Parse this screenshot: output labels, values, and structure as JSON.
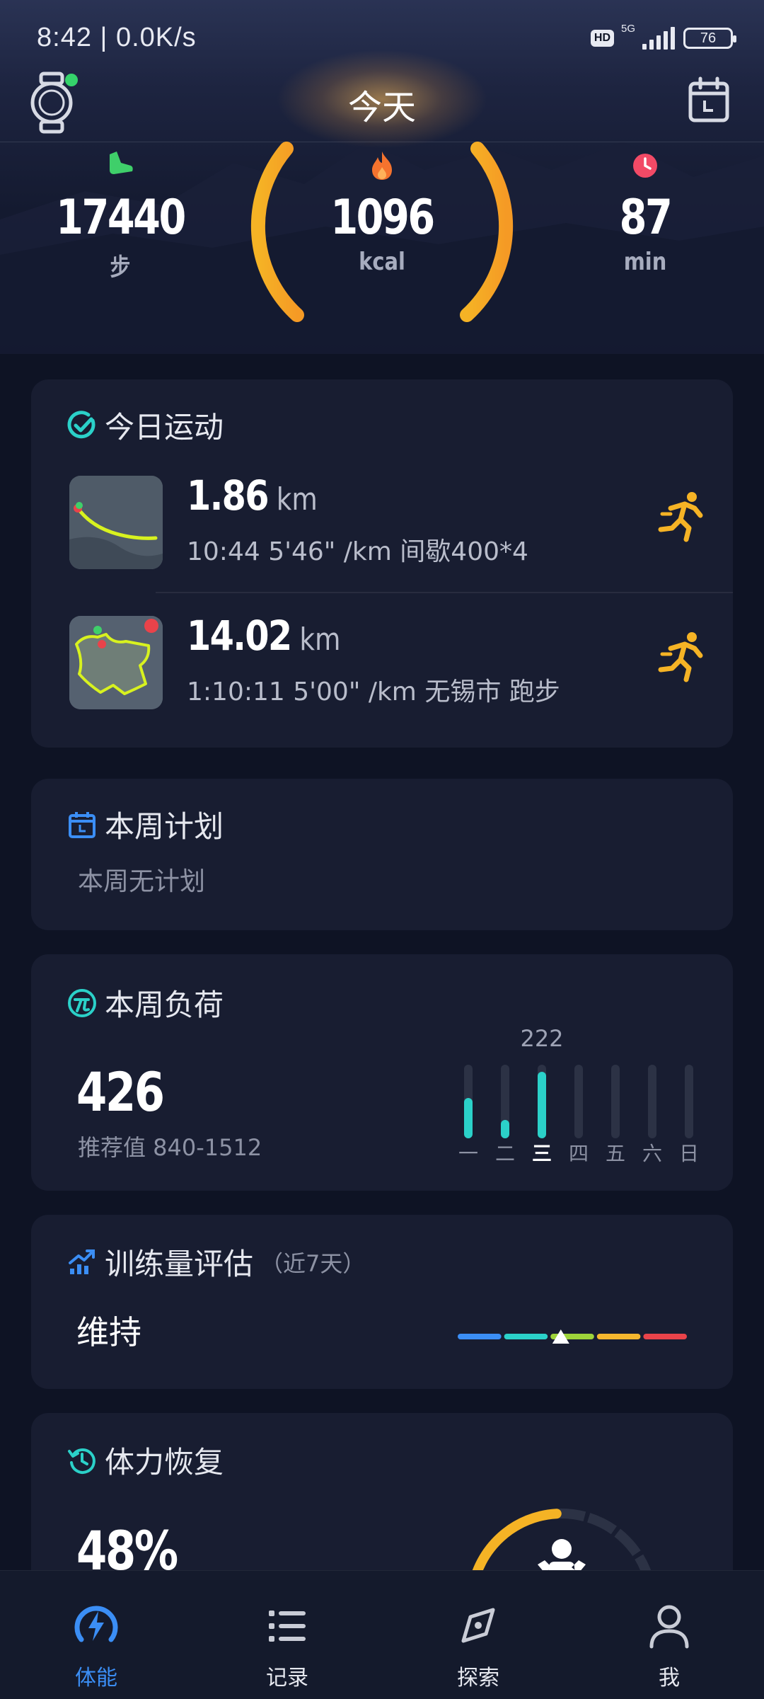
{
  "status_bar": {
    "time": "8:42 | 0.0K/s",
    "hd": "HD",
    "network": "5G",
    "battery": "76"
  },
  "header": {
    "title": "今天"
  },
  "stats": {
    "steps": {
      "value": "17440",
      "unit": "步"
    },
    "calories": {
      "value": "1096",
      "unit": "kcal"
    },
    "minutes": {
      "value": "87",
      "unit": "min"
    }
  },
  "today_exercise": {
    "title": "今日运动",
    "activities": [
      {
        "distance": "1.86",
        "unit": "km",
        "detail": "10:44 5'46\" /km  间歇400*4"
      },
      {
        "distance": "14.02",
        "unit": "km",
        "detail": "1:10:11 5'00\" /km  无锡市 跑步"
      }
    ]
  },
  "weekly_plan": {
    "title": "本周计划",
    "empty_text": "本周无计划"
  },
  "weekly_load": {
    "title": "本周负荷",
    "value": "426",
    "recommended": "推荐值 840-1512",
    "peak_label": "222",
    "days": [
      "一",
      "二",
      "三",
      "四",
      "五",
      "六",
      "日"
    ],
    "day_values": [
      0.55,
      0.25,
      0.9,
      0,
      0,
      0,
      0
    ],
    "today_index": 2
  },
  "training_assessment": {
    "title": "训练量评估",
    "subtitle": "（近7天）",
    "status": "维持",
    "indicator_position": 0.45,
    "segment_colors": [
      "#3b8ef5",
      "#2bd1c9",
      "#9ed43a",
      "#f5b72e",
      "#e9434a"
    ]
  },
  "recovery": {
    "title": "体力恢复",
    "value": "48%",
    "fraction": 0.48
  },
  "bottom_nav": {
    "items": [
      {
        "label": "体能",
        "active": true
      },
      {
        "label": "记录",
        "active": false
      },
      {
        "label": "探索",
        "active": false
      },
      {
        "label": "我",
        "active": false
      }
    ]
  }
}
